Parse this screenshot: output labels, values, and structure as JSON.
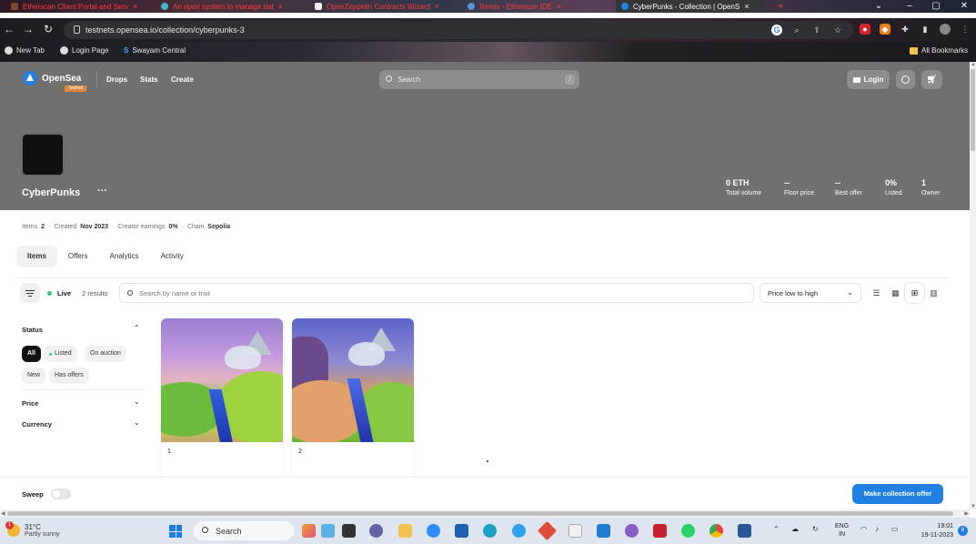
{
  "browser": {
    "tabs": [
      {
        "title": "Etherscan Client Portal and Serv",
        "color": "#ff3b3b",
        "active": false
      },
      {
        "title": "An open system to manage dat",
        "color": "#ff3b3b",
        "active": false
      },
      {
        "title": "OpenZeppelin Contracts Wizard",
        "color": "#ff3b3b",
        "active": false
      },
      {
        "title": "Remix - Ethereum IDE",
        "color": "#ff3b3b",
        "active": false
      },
      {
        "title": "CyberPunks - Collection | OpenS",
        "color": "#ffffff",
        "active": true
      }
    ],
    "url": "testnets.opensea.io/collection/cyberpunks-3",
    "bookmarks": [
      "New Tab",
      "Login Page",
      "Swayam Central"
    ],
    "all_bookmarks": "All Bookmarks"
  },
  "header": {
    "brand": "OpenSea",
    "badge": "Testnet",
    "nav": [
      "Drops",
      "Stats",
      "Create"
    ],
    "search_placeholder": "Search",
    "search_shortcut": "/",
    "login_label": "Login"
  },
  "collection": {
    "name": "CyberPunks",
    "more": "···",
    "stats": [
      {
        "value": "0 ETH",
        "label": "Total volume"
      },
      {
        "value": "--",
        "label": "Floor price"
      },
      {
        "value": "--",
        "label": "Best offer"
      },
      {
        "value": "0%",
        "label": "Listed"
      },
      {
        "value": "1",
        "label": "Owner"
      }
    ],
    "meta": {
      "items_label": "Items",
      "items_value": "2",
      "created_label": "Created",
      "created_value": "Nov 2023",
      "earnings_label": "Creator earnings",
      "earnings_value": "0%",
      "chain_label": "Chain",
      "chain_value": "Sepolia"
    }
  },
  "tabs": [
    "Items",
    "Offers",
    "Analytics",
    "Activity"
  ],
  "toolbar": {
    "live_label": "Live",
    "results": "2 results",
    "search_placeholder": "Search by name or trait",
    "sort_value": "Price low to high"
  },
  "filters": {
    "status_label": "Status",
    "status_options": [
      "All",
      "Listed",
      "On auction",
      "New",
      "Has offers"
    ],
    "price_label": "Price",
    "currency_label": "Currency"
  },
  "items": [
    {
      "name": "1"
    },
    {
      "name": "2"
    }
  ],
  "bottom": {
    "sweep_label": "Sweep",
    "offer_button": "Make collection offer"
  },
  "taskbar": {
    "temperature": "31°C",
    "weather": "Partly sunny",
    "weather_badge": "1",
    "search_label": "Search",
    "lang": "ENG",
    "region": "IN",
    "time": "19:01",
    "date": "19-11-2023",
    "notifications": "8"
  }
}
